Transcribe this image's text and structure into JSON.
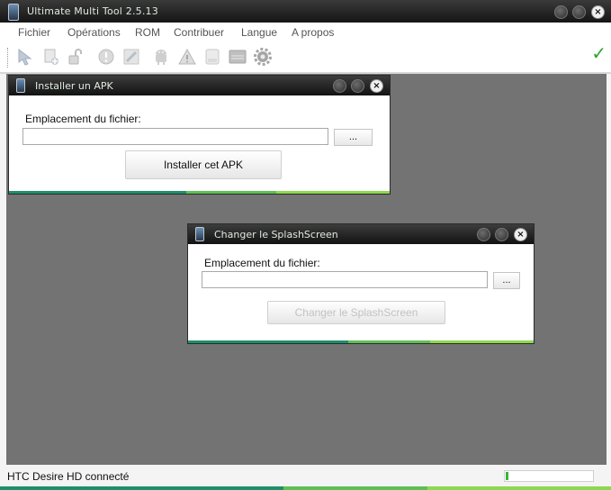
{
  "app": {
    "title": "Ultimate Multi Tool 2.5.13",
    "menu": [
      "Fichier",
      "Opérations",
      "ROM",
      "Contribuer",
      "Langue",
      "A propos"
    ],
    "toolbar_icons": [
      "arrow-cursor-icon",
      "add-file-icon",
      "unlock-icon",
      "warning-circle-icon",
      "brush-icon",
      "android-robot-icon",
      "hazard-triangle-icon",
      "blank-file-icon",
      "screen-icon",
      "gear-icon"
    ],
    "status_ok_icon": "checkmark-icon"
  },
  "dialogs": {
    "install_apk": {
      "title": "Installer un APK",
      "path_label": "Emplacement du fichier:",
      "path_value": "",
      "browse_label": "...",
      "action_label": "Installer cet APK"
    },
    "splash": {
      "title": "Changer le SplashScreen",
      "path_label": "Emplacement du fichier:",
      "path_value": "",
      "browse_label": "...",
      "action_label": "Changer le SplashScreen"
    }
  },
  "status": {
    "text": "HTC Desire HD connecté",
    "progress_fraction": 0.03
  },
  "colors": {
    "accent_dark_green": "#1f8f6a",
    "accent_light_green": "#8ed84e",
    "progress_green": "#37b637"
  }
}
